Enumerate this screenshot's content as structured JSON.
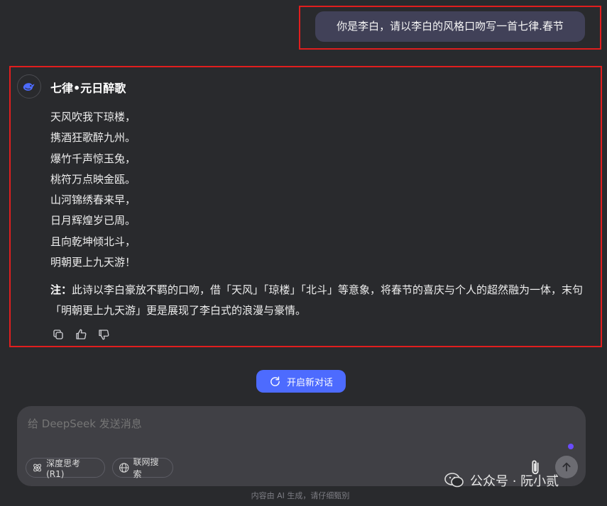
{
  "user_message": "你是李白，请以李白的风格口吻写一首七律.春节",
  "assistant": {
    "title": "七律•元日醉歌",
    "poem_lines": [
      "天风吹我下琼楼，",
      "携酒狂歌醉九州。",
      "爆竹千声惊玉兔，",
      "桃符万点映金瓯。",
      "山河锦绣春来早，",
      "日月辉煌岁已周。",
      "且向乾坤倾北斗，",
      "明朝更上九天游！"
    ],
    "note_label": "注：",
    "note_text": "此诗以李白豪放不羁的口吻，借「天风」「琼楼」「北斗」等意象，将春节的喜庆与个人的超然融为一体，末句「明朝更上九天游」更是展现了李白式的浪漫与豪情。",
    "action_icons": [
      "copy-icon",
      "thumbs-up-icon",
      "thumbs-down-icon"
    ]
  },
  "new_chat_label": "开启新对话",
  "composer": {
    "placeholder": "给 DeepSeek 发送消息",
    "deep_think_label": "深度思考 (R1)",
    "web_search_label": "联网搜索"
  },
  "watermark_text": "公众号 · 阮小贰",
  "disclaimer": "内容由 AI 生成，请仔细甄别",
  "colors": {
    "background": "#292a2d",
    "user_bubble": "#414158",
    "accent": "#4d6bfe",
    "highlight_frame": "#e11e1e",
    "composer": "#404045"
  }
}
